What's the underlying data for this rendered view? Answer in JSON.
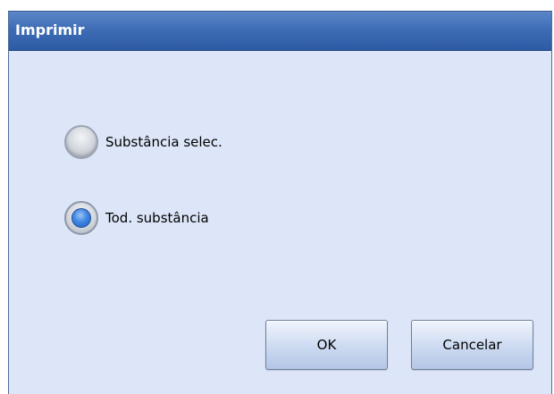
{
  "dialog": {
    "title": "Imprimir"
  },
  "options": [
    {
      "label": "Substância selec.",
      "selected": false
    },
    {
      "label": "Tod. substância",
      "selected": true
    }
  ],
  "buttons": {
    "ok_label": "OK",
    "cancel_label": "Cancelar"
  },
  "colors": {
    "titlebar": "#3f6db5",
    "dialog_background": "#dde6f8",
    "radio_selected": "#3f86e2"
  }
}
